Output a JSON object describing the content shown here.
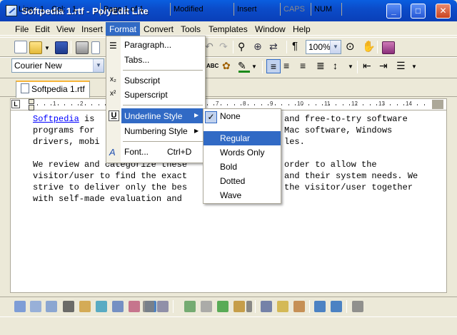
{
  "window": {
    "title": "Softpedia 1.rtf - PolyEdit Lite",
    "min_label": "_",
    "max_label": "□",
    "close_label": "✕"
  },
  "menubar": {
    "items": [
      "File",
      "Edit",
      "View",
      "Insert",
      "Format",
      "Convert",
      "Tools",
      "Templates",
      "Window",
      "Help"
    ]
  },
  "toolbar": {
    "zoom_value": "100%",
    "font_value": "Courier New"
  },
  "tab": {
    "label": "Softpedia 1.rtf"
  },
  "ruler": {
    "marks": [
      "1",
      "2",
      "3",
      "4",
      "5",
      "6",
      "7",
      "8",
      "9",
      "10",
      "11",
      "12",
      "13",
      "14",
      "15"
    ]
  },
  "document": {
    "line1_link": "Softpedia",
    "line1_a": " is ",
    "line1_b": "and free-to-try software",
    "line2_a": "programs for",
    "line2_b": "Mac software, Windows",
    "line3_a": "drivers, mobi",
    "line3_b": "les.",
    "line4_a": "We review and categorize these",
    "line4_b": "order to allow the",
    "line5_a": "visitor/user to find the exact",
    "line5_b": "and their system needs. We",
    "line6_a": "strive to deliver only the bes",
    "line6_b": "the visitor/user together",
    "line7_a": "with self-made evaluation and"
  },
  "format_menu": {
    "paragraph": "Paragraph...",
    "tabs": "Tabs...",
    "subscript": "Subscript",
    "superscript": "Superscript",
    "underline_style": "Underline Style",
    "numbering_style": "Numbering Style",
    "font": "Font...",
    "font_shortcut": "Ctrl+D"
  },
  "underline_menu": {
    "items": [
      "None",
      "Regular",
      "Words Only",
      "Bold",
      "Dotted",
      "Wave"
    ],
    "checked": "None",
    "highlighted": "Regular"
  },
  "statusbar": {
    "line_label": "Line:",
    "line_value": "1",
    "col_label": "Col:",
    "col_value": "1",
    "page": "Page 1 of 1",
    "modified": "Modified",
    "insert": "Insert",
    "caps": "CAPS",
    "num": "NUM"
  },
  "colors": {
    "accent": "#316ac5",
    "titlebar": "#0a5fe0",
    "link": "#0000ff"
  }
}
